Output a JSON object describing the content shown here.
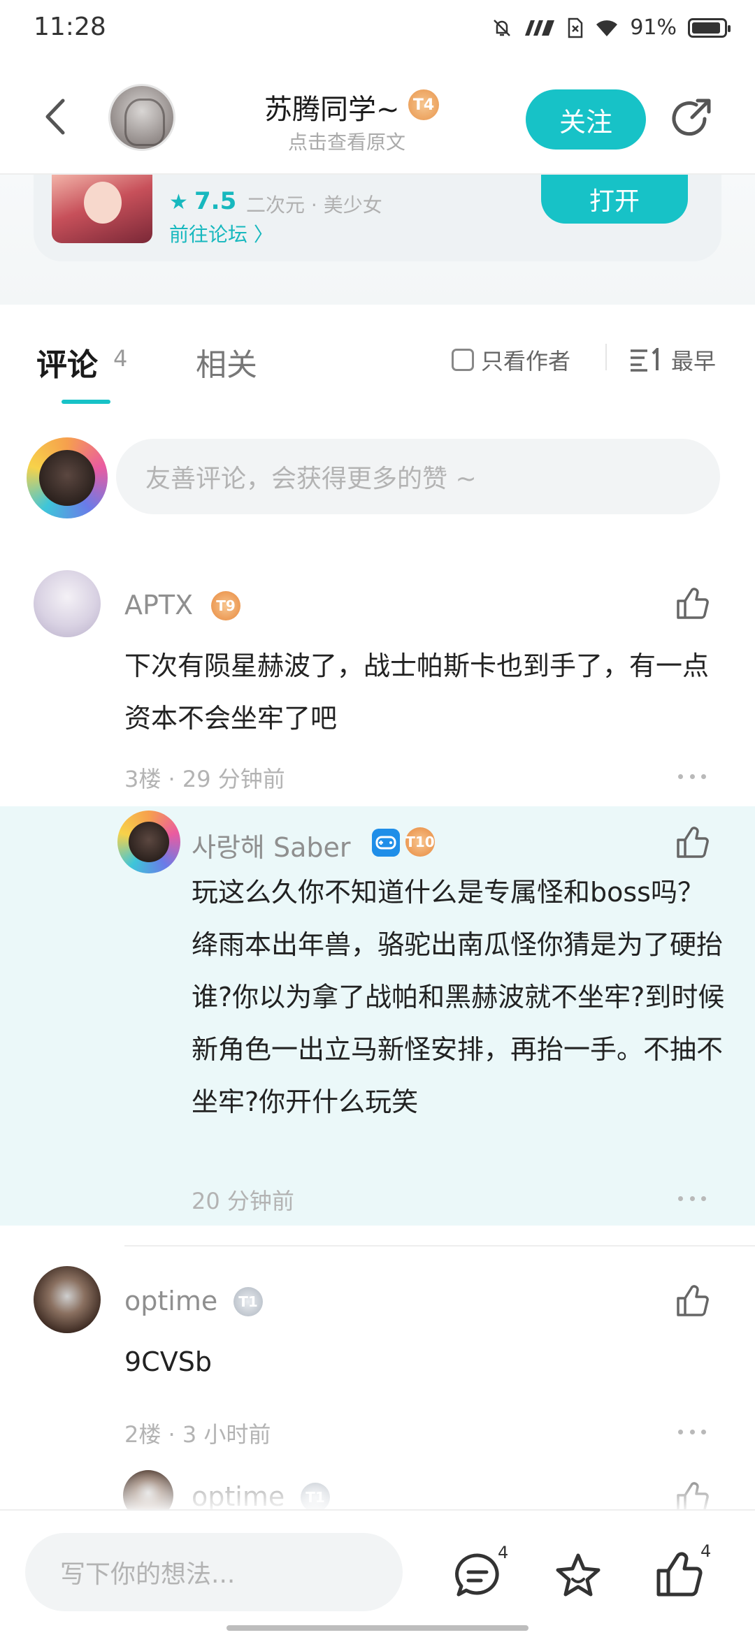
{
  "status_bar": {
    "time": "11:28",
    "battery": "91%",
    "battery_level": 0.91
  },
  "header": {
    "author_name": "苏腾同学~",
    "author_level": "T4",
    "view_original": "点击查看原文",
    "follow_label": "关注"
  },
  "game_card": {
    "rating": "7.5",
    "tags": "二次元 · 美少女",
    "forum_link": "前往论坛 〉",
    "open_label": "打开"
  },
  "tabs": {
    "comments_label": "评论",
    "comments_count": "4",
    "related_label": "相关",
    "author_only_label": "只看作者",
    "sort_label": "最早"
  },
  "comment_input": {
    "placeholder": "友善评论，会获得更多的赞 ~"
  },
  "comments": [
    {
      "name": "APTX",
      "level": "T9",
      "text": "下次有陨星赫波了，战士帕斯卡也到手了，有一点资本不会坐牢了吧",
      "meta": "3楼 · 29 分钟前"
    },
    {
      "name": "사랑해 Saber",
      "level": "T10",
      "text": "玩这么久你不知道什么是专属怪和boss吗？绛雨本出年兽，骆驼出南瓜怪你猜是为了硬抬谁?你以为拿了战帕和黑赫波就不坐牢?到时候新角色一出立马新怪安排，再抬一手。不抽不坐牢?你开什么玩笑",
      "meta": "20 分钟前"
    },
    {
      "name": "optime",
      "level": "T1",
      "text": "9CVSb",
      "meta": "2楼 · 3 小时前"
    },
    {
      "name": "optime",
      "level": "T1"
    }
  ],
  "bottom_bar": {
    "input_placeholder": "写下你的想法...",
    "comment_count": "4",
    "like_count": "4"
  },
  "colors": {
    "accent": "#17c2c7",
    "reply_bg": "#ebf8f9",
    "level_orange": "#e8893d"
  }
}
